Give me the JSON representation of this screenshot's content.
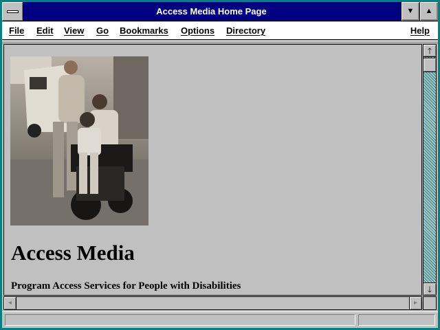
{
  "window": {
    "title": "Access Media Home Page"
  },
  "menubar": {
    "items": [
      "File",
      "Edit",
      "View",
      "Go",
      "Bookmarks",
      "Options",
      "Directory"
    ],
    "help": "Help"
  },
  "page": {
    "image": {
      "icon": "photo-family-wheelchair"
    },
    "heading": "Access Media",
    "subheading": "Program Access Services for People with Disabilities"
  },
  "scrollbars": {
    "vertical": {
      "up_icon": "arrow-up-icon",
      "down_icon": "arrow-down-icon",
      "position": 0
    },
    "horizontal": {
      "left_icon": "arrow-left-icon",
      "right_icon": "arrow-right-icon",
      "position": 0
    }
  },
  "statusbar": {
    "text": "",
    "progress": 0
  },
  "colors": {
    "titlebar": "#000080",
    "frame": "#008080",
    "background": "#c0c0c0"
  }
}
